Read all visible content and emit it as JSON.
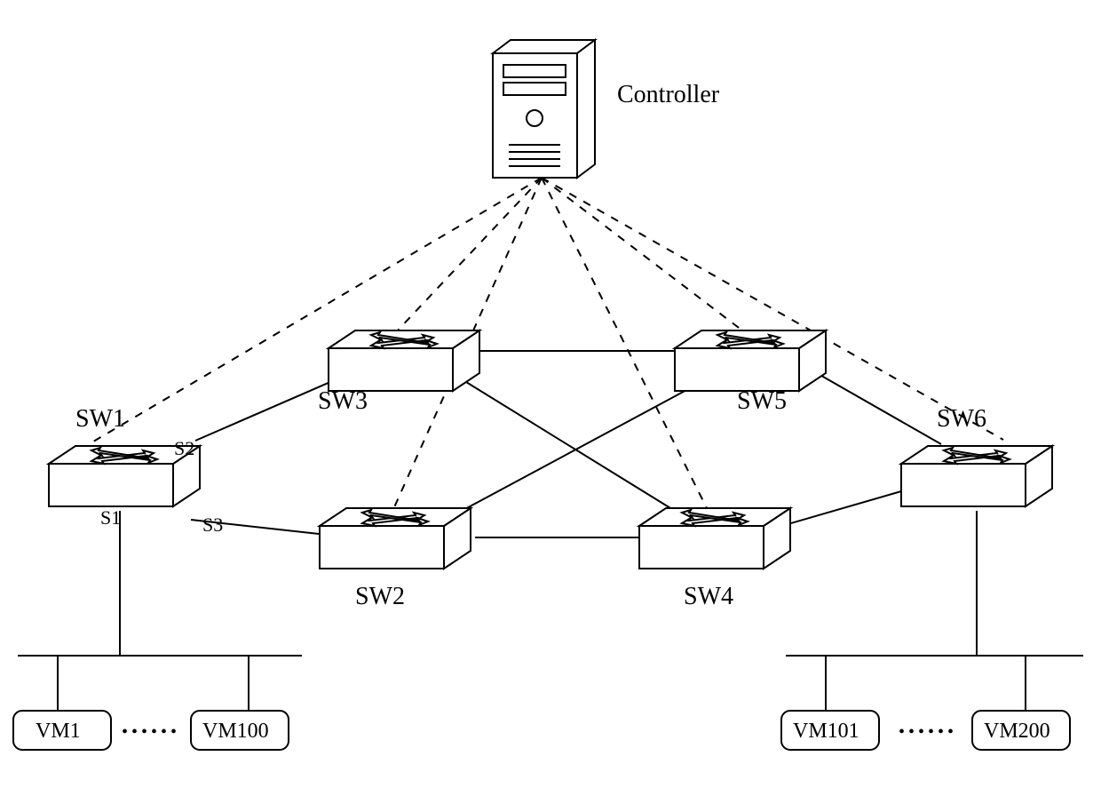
{
  "controller": {
    "label": "Controller"
  },
  "switches": {
    "sw1": {
      "label": "SW1"
    },
    "sw2": {
      "label": "SW2"
    },
    "sw3": {
      "label": "SW3"
    },
    "sw4": {
      "label": "SW4"
    },
    "sw5": {
      "label": "SW5"
    },
    "sw6": {
      "label": "SW6"
    }
  },
  "ports": {
    "s1": {
      "label": "S1"
    },
    "s2": {
      "label": "S2"
    },
    "s3": {
      "label": "S3"
    }
  },
  "vms": {
    "vm1": {
      "label": "VM1"
    },
    "vm100": {
      "label": "VM100"
    },
    "vm101": {
      "label": "VM101"
    },
    "vm200": {
      "label": "VM200"
    }
  },
  "ellipsis": "••••••"
}
